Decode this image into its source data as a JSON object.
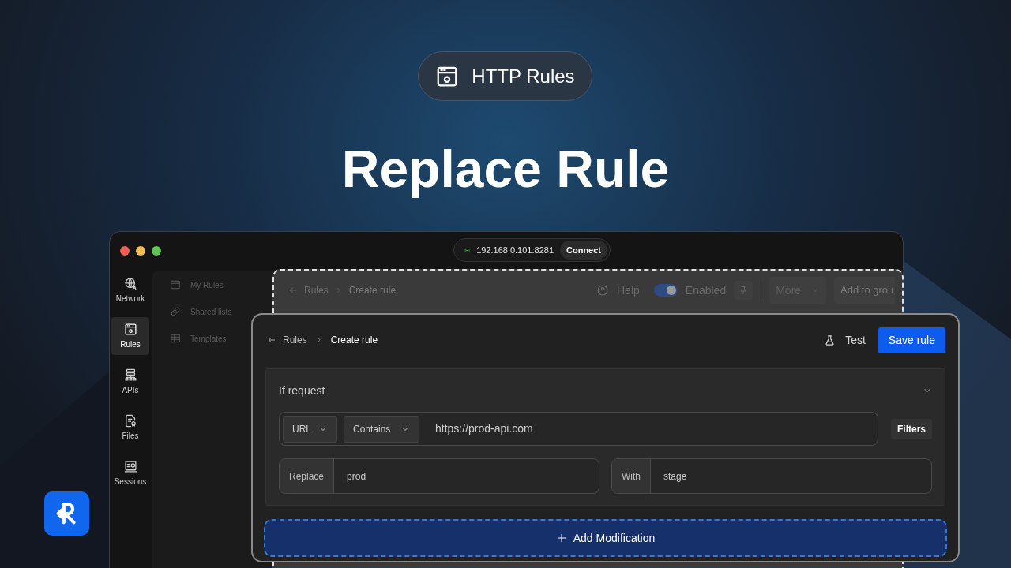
{
  "badge": {
    "label": "HTTP Rules"
  },
  "headline": "Replace Rule",
  "connection": {
    "address": "192.168.0.101:8281",
    "button": "Connect"
  },
  "rail": [
    {
      "label": "Network",
      "kind": "globe",
      "selected": false
    },
    {
      "label": "Rules",
      "kind": "rules",
      "selected": true
    },
    {
      "label": "APIs",
      "kind": "apis",
      "selected": false
    },
    {
      "label": "Files",
      "kind": "files",
      "selected": false
    },
    {
      "label": "Sessions",
      "kind": "sessions",
      "selected": false
    }
  ],
  "sidebar": [
    {
      "label": "My Rules",
      "kind": "folder"
    },
    {
      "label": "Shared lists",
      "kind": "link"
    },
    {
      "label": "Templates",
      "kind": "table"
    }
  ],
  "background_editor": {
    "back": "Rules",
    "current": "Create rule",
    "help": "Help",
    "toggle": {
      "label": "Enabled",
      "on": true
    },
    "more": "More",
    "add_to_group": "Add to grou"
  },
  "editor": {
    "back": "Rules",
    "current": "Create rule",
    "test": "Test",
    "save": "Save rule",
    "section": {
      "title": "If request",
      "expanded": true,
      "match": {
        "field": "URL",
        "operator": "Contains",
        "value": "https://prod-api.com"
      },
      "filters": "Filters",
      "replace": {
        "label": "Replace",
        "value": "prod"
      },
      "with": {
        "label": "With",
        "value": "stage"
      }
    },
    "add": "Add Modification"
  }
}
